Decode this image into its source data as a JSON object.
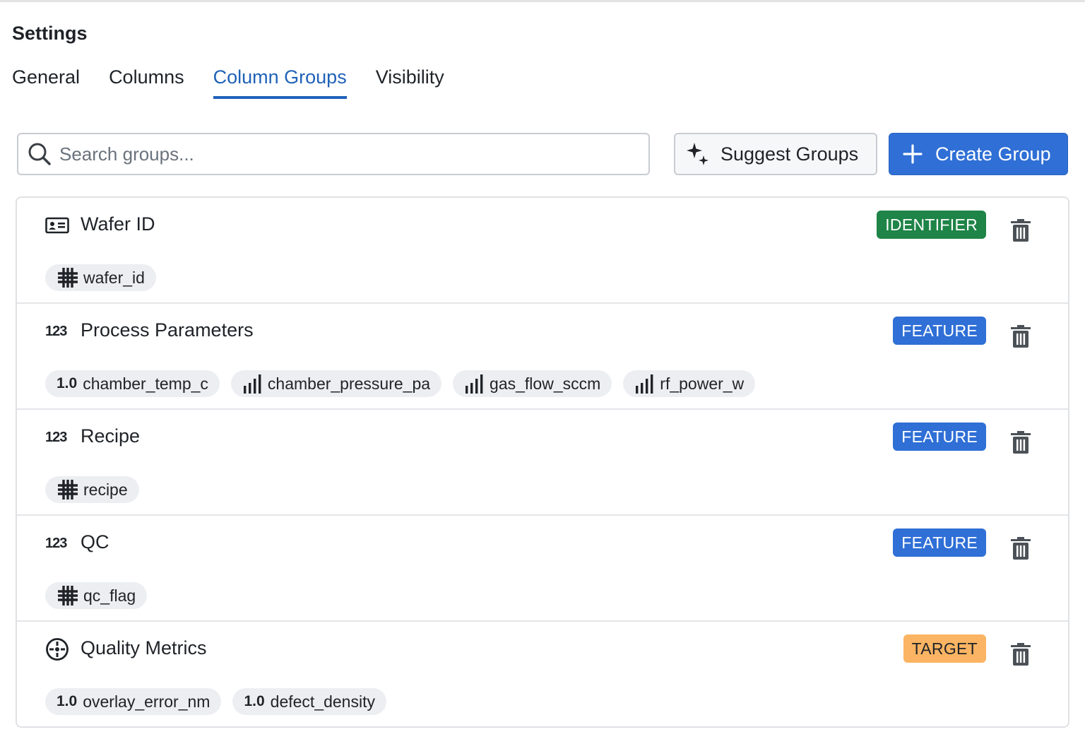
{
  "page": {
    "title": "Settings"
  },
  "tabs": [
    {
      "label": "General",
      "active": false
    },
    {
      "label": "Columns",
      "active": false
    },
    {
      "label": "Column Groups",
      "active": true
    },
    {
      "label": "Visibility",
      "active": false
    }
  ],
  "search": {
    "placeholder": "Search groups...",
    "value": "",
    "icon": "search-icon"
  },
  "actions": {
    "suggest_label": "Suggest Groups",
    "suggest_icon": "sparkles-icon",
    "create_label": "Create Group",
    "create_icon": "plus-icon"
  },
  "colors": {
    "accent": "#2f6fd6",
    "tab_active": "#1f62b8",
    "identifier": "#1e8447",
    "feature": "#2f6fd6",
    "target": "#fbb463",
    "chip_bg": "#eceef1"
  },
  "groups": [
    {
      "name": "Wafer ID",
      "icon": "id-card-icon",
      "role": "IDENTIFIER",
      "columns": [
        {
          "name": "wafer_id",
          "icon": "categorical-grid-icon"
        }
      ]
    },
    {
      "name": "Process Parameters",
      "icon": "123",
      "role": "FEATURE",
      "columns": [
        {
          "name": "chamber_temp_c",
          "icon": "1.0"
        },
        {
          "name": "chamber_pressure_pa",
          "icon": "signal-bars-icon"
        },
        {
          "name": "gas_flow_sccm",
          "icon": "signal-bars-icon"
        },
        {
          "name": "rf_power_w",
          "icon": "signal-bars-icon"
        }
      ]
    },
    {
      "name": "Recipe",
      "icon": "123",
      "role": "FEATURE",
      "columns": [
        {
          "name": "recipe",
          "icon": "categorical-grid-icon"
        }
      ]
    },
    {
      "name": "QC",
      "icon": "123",
      "role": "FEATURE",
      "columns": [
        {
          "name": "qc_flag",
          "icon": "categorical-grid-icon"
        }
      ]
    },
    {
      "name": "Quality Metrics",
      "icon": "target-icon",
      "role": "TARGET",
      "columns": [
        {
          "name": "overlay_error_nm",
          "icon": "1.0"
        },
        {
          "name": "defect_density",
          "icon": "1.0"
        }
      ]
    }
  ]
}
